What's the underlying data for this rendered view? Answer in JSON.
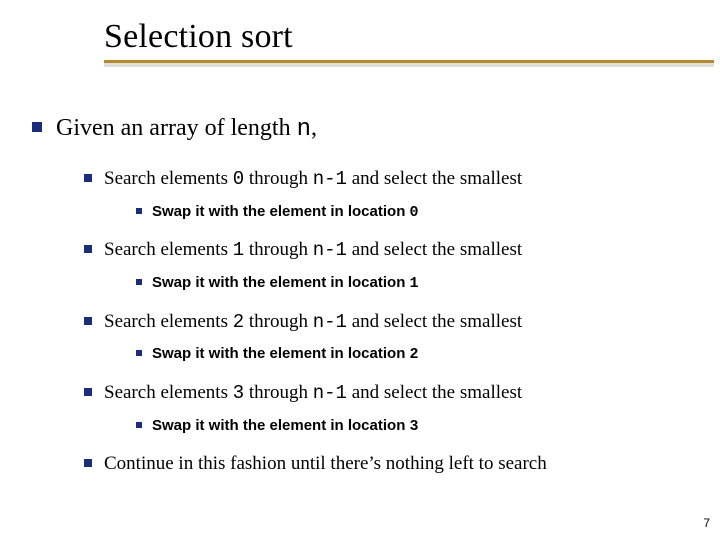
{
  "title": "Selection sort",
  "page_number": "7",
  "l1": {
    "pre": "Given an array of length ",
    "code": "n",
    "post": ","
  },
  "l2": [
    {
      "pre": "Search elements ",
      "c1": "0",
      "mid": " through ",
      "c2": "n-1",
      "post": " and select the smallest"
    },
    {
      "pre": "Search elements ",
      "c1": "1",
      "mid": " through ",
      "c2": "n-1",
      "post": " and select the smallest"
    },
    {
      "pre": "Search elements ",
      "c1": "2",
      "mid": " through ",
      "c2": "n-1",
      "post": " and select the smallest"
    },
    {
      "pre": "Search elements ",
      "c1": "3",
      "mid": " through ",
      "c2": "n-1",
      "post": " and select the smallest"
    }
  ],
  "l3": [
    {
      "pre": "Swap it with the element in location ",
      "c": "0"
    },
    {
      "pre": "Swap it with the element in location ",
      "c": "1"
    },
    {
      "pre": "Swap it with the element in location ",
      "c": "2"
    },
    {
      "pre": "Swap it with the element in location ",
      "c": "3"
    }
  ],
  "l2_final": "Continue in this fashion until there’s nothing left to search"
}
